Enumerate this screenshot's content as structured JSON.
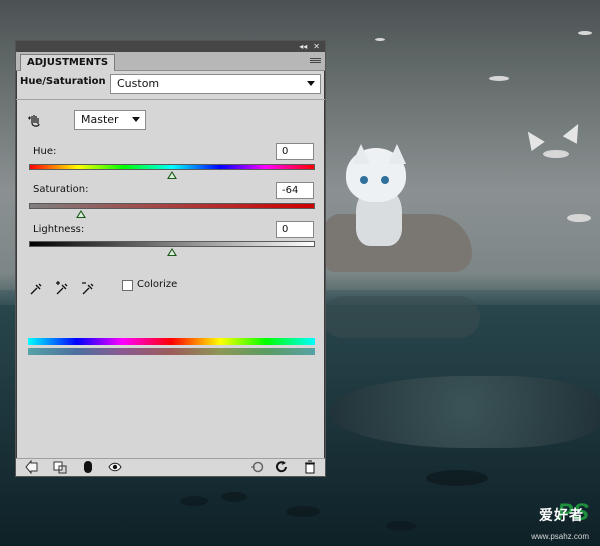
{
  "panel": {
    "tab_label": "ADJUSTMENTS",
    "adjustment_name": "Hue/Saturation",
    "preset_value": "Custom",
    "channel_value": "Master",
    "hue_label": "Hue:",
    "hue_value": "0",
    "saturation_label": "Saturation:",
    "saturation_value": "-64",
    "lightness_label": "Lightness:",
    "lightness_value": "0",
    "colorize_label": "Colorize",
    "slider_levels": {
      "hue": 0.5,
      "saturation": 0.18,
      "lightness": 0.5
    },
    "icons": [
      "collapse-icon",
      "close-icon",
      "panel-menu-icon",
      "hand-adjust-icon",
      "eyedropper-icon",
      "eyedropper-plus-icon",
      "eyedropper-minus-icon",
      "back-arrow-icon",
      "clip-layer-icon",
      "mask-icon",
      "visibility-eye-icon",
      "previous-state-icon",
      "reset-icon",
      "trash-icon"
    ]
  },
  "watermark": {
    "mark": "PS",
    "text": "爱好者",
    "url": "www.psahz.com"
  }
}
